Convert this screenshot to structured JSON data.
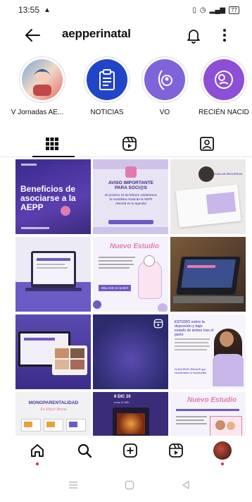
{
  "status": {
    "time": "13:55",
    "battery": "77"
  },
  "header": {
    "title": "aepperinatal"
  },
  "highlights": [
    {
      "label": "V Jornadas AE..."
    },
    {
      "label": "NOTICIAS"
    },
    {
      "label": "VO"
    },
    {
      "label": "RECIÉN NACID"
    }
  ],
  "tabs": [
    {
      "name": "grid",
      "icon": "grid-icon"
    },
    {
      "name": "reels",
      "icon": "reels-icon"
    },
    {
      "name": "tagged",
      "icon": "tagged-icon"
    }
  ],
  "posts": [
    {
      "text": "Beneficios de asociarse a la AEPP"
    },
    {
      "heading": "AVISO IMPORTANTE PARA SOCI@S",
      "body": "El próximo 22 de febrero celebramos la Asamblea Anual de la AEPP ¡Revisá en tu agenda!"
    },
    {
      "label": "GUÍA DE RECURSOS"
    },
    {
      "label": ""
    },
    {
      "heading": "Nuevo Estudio",
      "button": "ENLACE en la BIO"
    },
    {
      "label": ""
    },
    {
      "label": ""
    },
    {
      "label": ""
    },
    {
      "heading": "ESTUDIO sobre la depresión y bajo estado de ánimo tras el parto",
      "footer": "CLICA EN EL ENLACE que encontrarás en nuestra Bio"
    },
    {
      "heading": "MONOPARENTALIDAD",
      "sub": "En Mayor Bienal"
    },
    {
      "heading": "6 DIC 20",
      "sub": "a las 11:00h"
    },
    {
      "heading": "Nuevo Estudio",
      "button": "ENLACE en la BIO"
    }
  ],
  "colors": {
    "purple": "#6b5bc4",
    "lavender": "#c9b7ea",
    "pink": "#e07bb0"
  }
}
